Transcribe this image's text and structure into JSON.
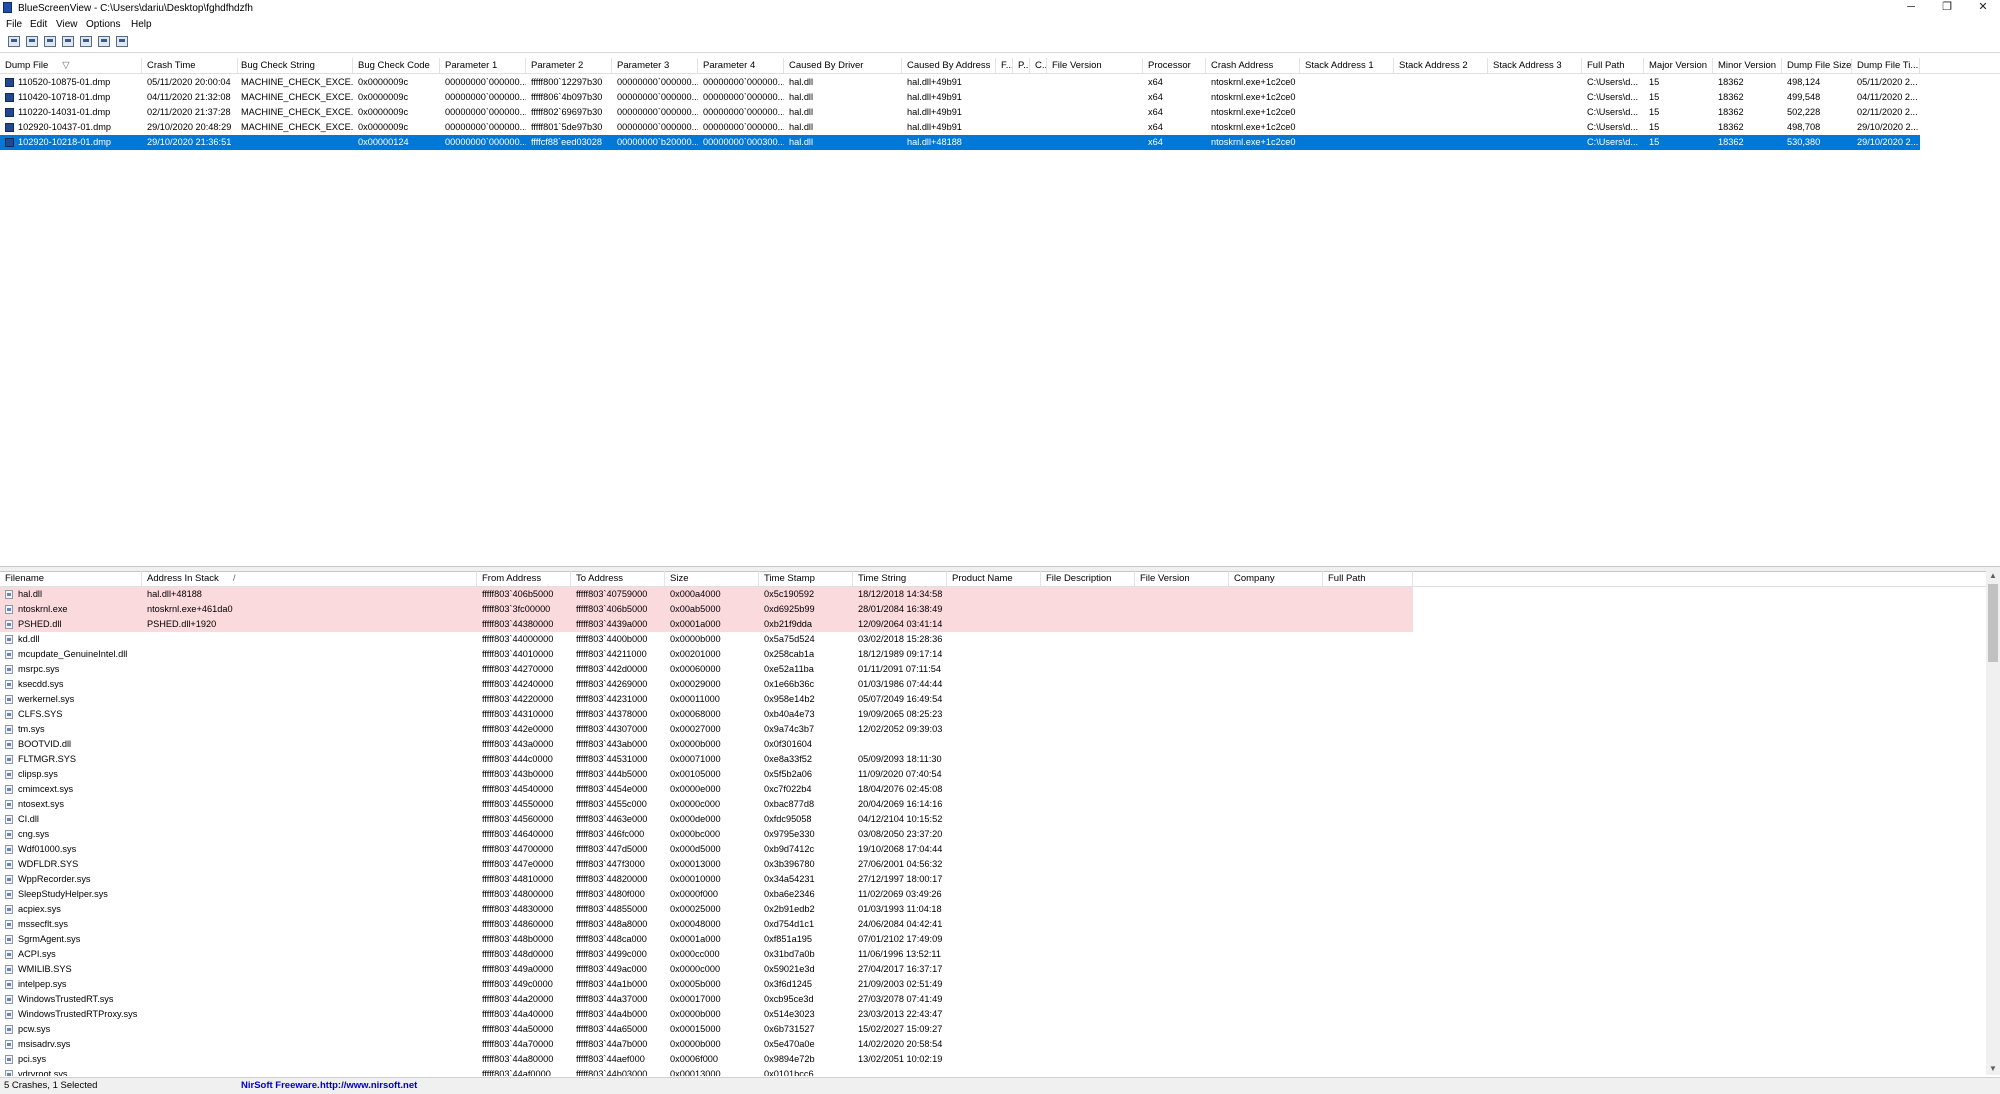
{
  "window": {
    "title": "BlueScreenView  -  C:\\Users\\dariu\\Desktop\\fghdfhdzfh",
    "minimize": "─",
    "restore": "❐",
    "close": "✕"
  },
  "menu": [
    "File",
    "Edit",
    "View",
    "Options",
    "Help"
  ],
  "toolbar": [
    "save-selected-icon",
    "save-icon",
    "refresh-icon",
    "copy-icon",
    "properties-icon",
    "find-icon",
    "exit-icon"
  ],
  "crash_list": {
    "columns": [
      {
        "label": "Dump File",
        "sort": "▽"
      },
      {
        "label": "Crash Time"
      },
      {
        "label": "Bug Check String"
      },
      {
        "label": "Bug Check Code"
      },
      {
        "label": "Parameter 1"
      },
      {
        "label": "Parameter 2"
      },
      {
        "label": "Parameter 3"
      },
      {
        "label": "Parameter 4"
      },
      {
        "label": "Caused By Driver"
      },
      {
        "label": "Caused By Address"
      },
      {
        "label": "F..."
      },
      {
        "label": "P..."
      },
      {
        "label": "C..."
      },
      {
        "label": "File Version"
      },
      {
        "label": "Processor"
      },
      {
        "label": "Crash Address"
      },
      {
        "label": "Stack Address 1"
      },
      {
        "label": "Stack Address 2"
      },
      {
        "label": "Stack Address 3"
      },
      {
        "label": "Full Path"
      },
      {
        "label": "Major Version"
      },
      {
        "label": "Minor Version"
      },
      {
        "label": "Dump File Size"
      },
      {
        "label": "Dump File Ti..."
      }
    ],
    "rows": [
      [
        "110520-10875-01.dmp",
        "05/11/2020 20:00:04",
        "MACHINE_CHECK_EXCE...",
        "0x0000009c",
        "00000000`000000...",
        "fffff800`12297b30",
        "00000000`000000...",
        "00000000`000000...",
        "hal.dll",
        "hal.dll+49b91",
        "",
        "",
        "",
        "",
        "x64",
        "ntoskrnl.exe+1c2ce0",
        "",
        "",
        "",
        "C:\\Users\\d...",
        "15",
        "18362",
        "498,124",
        "05/11/2020 2..."
      ],
      [
        "110420-10718-01.dmp",
        "04/11/2020 21:32:08",
        "MACHINE_CHECK_EXCE...",
        "0x0000009c",
        "00000000`000000...",
        "fffff806`4b097b30",
        "00000000`000000...",
        "00000000`000000...",
        "hal.dll",
        "hal.dll+49b91",
        "",
        "",
        "",
        "",
        "x64",
        "ntoskrnl.exe+1c2ce0",
        "",
        "",
        "",
        "C:\\Users\\d...",
        "15",
        "18362",
        "499,548",
        "04/11/2020 2..."
      ],
      [
        "110220-14031-01.dmp",
        "02/11/2020 21:37:28",
        "MACHINE_CHECK_EXCE...",
        "0x0000009c",
        "00000000`000000...",
        "fffff802`69697b30",
        "00000000`000000...",
        "00000000`000000...",
        "hal.dll",
        "hal.dll+49b91",
        "",
        "",
        "",
        "",
        "x64",
        "ntoskrnl.exe+1c2ce0",
        "",
        "",
        "",
        "C:\\Users\\d...",
        "15",
        "18362",
        "502,228",
        "02/11/2020 2..."
      ],
      [
        "102920-10437-01.dmp",
        "29/10/2020 20:48:29",
        "MACHINE_CHECK_EXCE...",
        "0x0000009c",
        "00000000`000000...",
        "fffff801`5de97b30",
        "00000000`000000...",
        "00000000`000000...",
        "hal.dll",
        "hal.dll+49b91",
        "",
        "",
        "",
        "",
        "x64",
        "ntoskrnl.exe+1c2ce0",
        "",
        "",
        "",
        "C:\\Users\\d...",
        "15",
        "18362",
        "498,708",
        "29/10/2020 2..."
      ],
      [
        "102920-10218-01.dmp",
        "29/10/2020 21:36:51",
        "",
        "0x00000124",
        "00000000`000000...",
        "ffffcf88`eed03028",
        "00000000`b20000...",
        "00000000`000300...",
        "hal.dll",
        "hal.dll+48188",
        "",
        "",
        "",
        "",
        "x64",
        "ntoskrnl.exe+1c2ce0",
        "",
        "",
        "",
        "C:\\Users\\d...",
        "15",
        "18362",
        "530,380",
        "29/10/2020 2..."
      ]
    ],
    "selected_index": 4
  },
  "driver_list": {
    "columns": [
      {
        "label": "Filename"
      },
      {
        "label": "Address In Stack",
        "sort": "/"
      },
      {
        "label": "From Address"
      },
      {
        "label": "To Address"
      },
      {
        "label": "Size"
      },
      {
        "label": "Time Stamp"
      },
      {
        "label": "Time String"
      },
      {
        "label": "Product Name"
      },
      {
        "label": "File Description"
      },
      {
        "label": "File Version"
      },
      {
        "label": "Company"
      },
      {
        "label": "Full Path"
      }
    ],
    "rows": [
      [
        "hal.dll",
        "hal.dll+48188",
        "fffff803`406b5000",
        "fffff803`40759000",
        "0x000a4000",
        "0x5c190592",
        "18/12/2018 14:34:58"
      ],
      [
        "ntoskrnl.exe",
        "ntoskrnl.exe+461da0",
        "fffff803`3fc00000",
        "fffff803`406b5000",
        "0x00ab5000",
        "0xd6925b99",
        "28/01/2084 16:38:49"
      ],
      [
        "PSHED.dll",
        "PSHED.dll+1920",
        "fffff803`44380000",
        "fffff803`4439a000",
        "0x0001a000",
        "0xb21f9dda",
        "12/09/2064 03:41:14"
      ],
      [
        "kd.dll",
        "",
        "fffff803`44000000",
        "fffff803`4400b000",
        "0x0000b000",
        "0x5a75d524",
        "03/02/2018 15:28:36"
      ],
      [
        "mcupdate_GenuineIntel.dll",
        "",
        "fffff803`44010000",
        "fffff803`44211000",
        "0x00201000",
        "0x258cab1a",
        "18/12/1989 09:17:14"
      ],
      [
        "msrpc.sys",
        "",
        "fffff803`44270000",
        "fffff803`442d0000",
        "0x00060000",
        "0xe52a11ba",
        "01/11/2091 07:11:54"
      ],
      [
        "ksecdd.sys",
        "",
        "fffff803`44240000",
        "fffff803`44269000",
        "0x00029000",
        "0x1e66b36c",
        "01/03/1986 07:44:44"
      ],
      [
        "werkernel.sys",
        "",
        "fffff803`44220000",
        "fffff803`44231000",
        "0x00011000",
        "0x958e14b2",
        "05/07/2049 16:49:54"
      ],
      [
        "CLFS.SYS",
        "",
        "fffff803`44310000",
        "fffff803`44378000",
        "0x00068000",
        "0xb40a4e73",
        "19/09/2065 08:25:23"
      ],
      [
        "tm.sys",
        "",
        "fffff803`442e0000",
        "fffff803`44307000",
        "0x00027000",
        "0x9a74c3b7",
        "12/02/2052 09:39:03"
      ],
      [
        "BOOTVID.dll",
        "",
        "fffff803`443a0000",
        "fffff803`443ab000",
        "0x0000b000",
        "0x0f301604",
        ""
      ],
      [
        "FLTMGR.SYS",
        "",
        "fffff803`444c0000",
        "fffff803`44531000",
        "0x00071000",
        "0xe8a33f52",
        "05/09/2093 18:11:30"
      ],
      [
        "clipsp.sys",
        "",
        "fffff803`443b0000",
        "fffff803`444b5000",
        "0x00105000",
        "0x5f5b2a06",
        "11/09/2020 07:40:54"
      ],
      [
        "cmimcext.sys",
        "",
        "fffff803`44540000",
        "fffff803`4454e000",
        "0x0000e000",
        "0xc7f022b4",
        "18/04/2076 02:45:08"
      ],
      [
        "ntosext.sys",
        "",
        "fffff803`44550000",
        "fffff803`4455c000",
        "0x0000c000",
        "0xbac877d8",
        "20/04/2069 16:14:16"
      ],
      [
        "CI.dll",
        "",
        "fffff803`44560000",
        "fffff803`4463e000",
        "0x000de000",
        "0xfdc95058",
        "04/12/2104 10:15:52"
      ],
      [
        "cng.sys",
        "",
        "fffff803`44640000",
        "fffff803`446fc000",
        "0x000bc000",
        "0x9795e330",
        "03/08/2050 23:37:20"
      ],
      [
        "Wdf01000.sys",
        "",
        "fffff803`44700000",
        "fffff803`447d5000",
        "0x000d5000",
        "0xb9d7412c",
        "19/10/2068 17:04:44"
      ],
      [
        "WDFLDR.SYS",
        "",
        "fffff803`447e0000",
        "fffff803`447f3000",
        "0x00013000",
        "0x3b396780",
        "27/06/2001 04:56:32"
      ],
      [
        "WppRecorder.sys",
        "",
        "fffff803`44810000",
        "fffff803`44820000",
        "0x00010000",
        "0x34a54231",
        "27/12/1997 18:00:17"
      ],
      [
        "SleepStudyHelper.sys",
        "",
        "fffff803`44800000",
        "fffff803`4480f000",
        "0x0000f000",
        "0xba6e2346",
        "11/02/2069 03:49:26"
      ],
      [
        "acpiex.sys",
        "",
        "fffff803`44830000",
        "fffff803`44855000",
        "0x00025000",
        "0x2b91edb2",
        "01/03/1993 11:04:18"
      ],
      [
        "mssecflt.sys",
        "",
        "fffff803`44860000",
        "fffff803`448a8000",
        "0x00048000",
        "0xd754d1c1",
        "24/06/2084 04:42:41"
      ],
      [
        "SgrmAgent.sys",
        "",
        "fffff803`448b0000",
        "fffff803`448ca000",
        "0x0001a000",
        "0xf851a195",
        "07/01/2102 17:49:09"
      ],
      [
        "ACPI.sys",
        "",
        "fffff803`448d0000",
        "fffff803`4499c000",
        "0x000cc000",
        "0x31bd7a0b",
        "11/06/1996 13:52:11"
      ],
      [
        "WMILIB.SYS",
        "",
        "fffff803`449a0000",
        "fffff803`449ac000",
        "0x0000c000",
        "0x59021e3d",
        "27/04/2017 16:37:17"
      ],
      [
        "intelpep.sys",
        "",
        "fffff803`449c0000",
        "fffff803`44a1b000",
        "0x0005b000",
        "0x3f6d1245",
        "21/09/2003 02:51:49"
      ],
      [
        "WindowsTrustedRT.sys",
        "",
        "fffff803`44a20000",
        "fffff803`44a37000",
        "0x00017000",
        "0xcb95ce3d",
        "27/03/2078 07:41:49"
      ],
      [
        "WindowsTrustedRTProxy.sys",
        "",
        "fffff803`44a40000",
        "fffff803`44a4b000",
        "0x0000b000",
        "0x514e3023",
        "23/03/2013 22:43:47"
      ],
      [
        "pcw.sys",
        "",
        "fffff803`44a50000",
        "fffff803`44a65000",
        "0x00015000",
        "0x6b731527",
        "15/02/2027 15:09:27"
      ],
      [
        "msisadrv.sys",
        "",
        "fffff803`44a70000",
        "fffff803`44a7b000",
        "0x0000b000",
        "0x5e470a0e",
        "14/02/2020 20:58:54"
      ],
      [
        "pci.sys",
        "",
        "fffff803`44a80000",
        "fffff803`44aef000",
        "0x0006f000",
        "0x9894e72b",
        "13/02/2051 10:02:19"
      ],
      [
        "vdrvroot.sys",
        "",
        "fffff803`44af0000",
        "fffff803`44b03000",
        "0x00013000",
        "0x0101bcc6",
        ""
      ]
    ],
    "highlighted_count": 3
  },
  "status": {
    "left": "5 Crashes, 1 Selected",
    "freeware": "NirSoft Freeware.",
    "url": "http://www.nirsoft.net"
  }
}
